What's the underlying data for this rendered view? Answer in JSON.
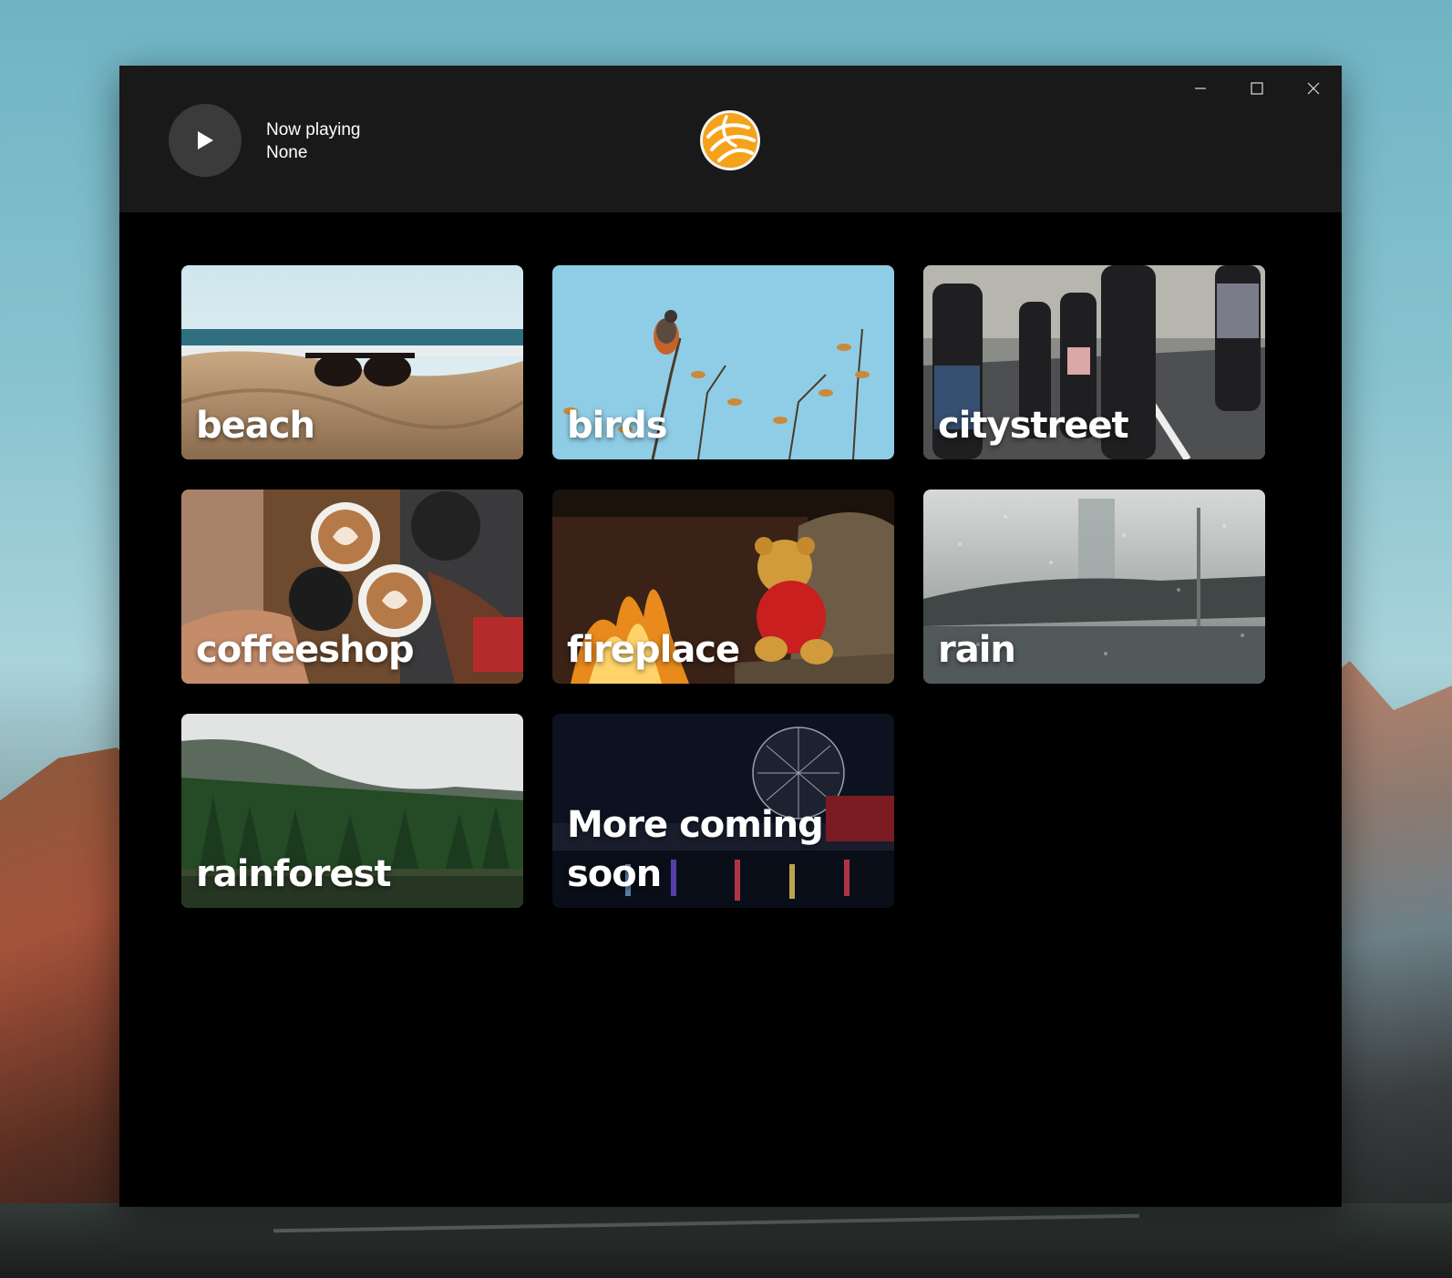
{
  "player": {
    "now_playing_label": "Now playing",
    "track": "None"
  },
  "window_controls": {
    "minimize": "minimize-icon",
    "maximize": "maximize-icon",
    "close": "close-icon"
  },
  "tiles": [
    {
      "label": "beach"
    },
    {
      "label": "birds"
    },
    {
      "label": "citystreet"
    },
    {
      "label": "coffeeshop"
    },
    {
      "label": "fireplace"
    },
    {
      "label": "rain"
    },
    {
      "label": "rainforest"
    },
    {
      "label": "More coming soon"
    }
  ],
  "colors": {
    "titlebar": "#191919",
    "content": "#000000",
    "play_button": "#3b3b3b",
    "logo_orange": "#f5a21b"
  }
}
